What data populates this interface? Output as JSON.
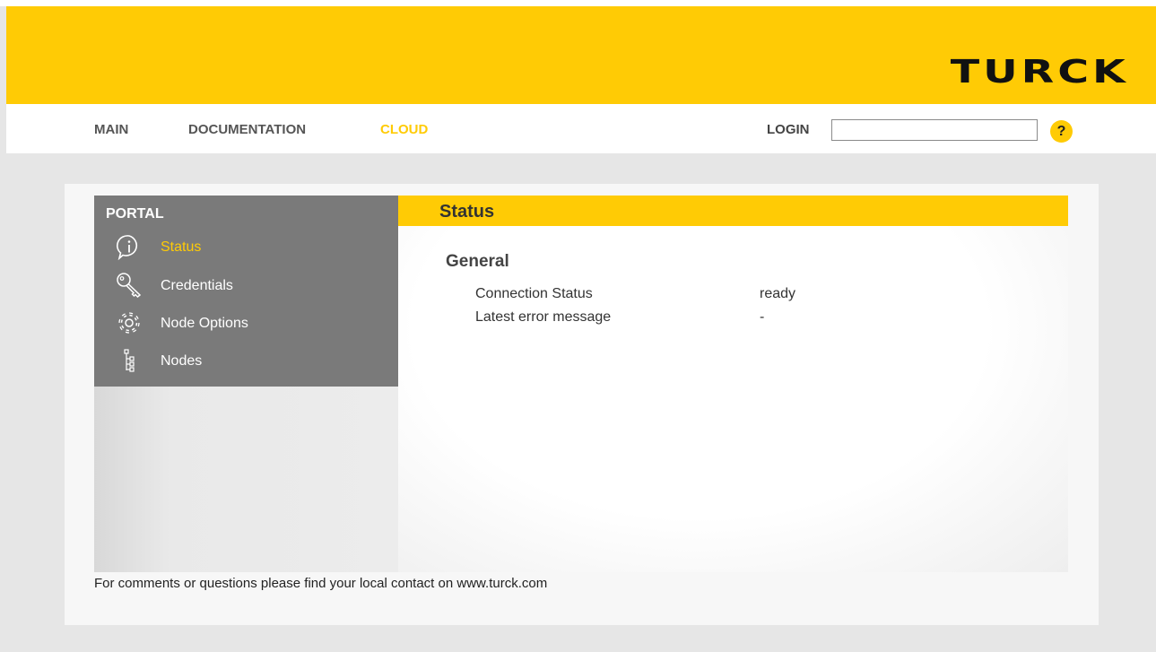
{
  "brand": {
    "logo_text": "TURCK",
    "accent_color": "#ffcb05"
  },
  "nav": {
    "items": [
      {
        "label": "MAIN"
      },
      {
        "label": "DOCUMENTATION"
      },
      {
        "label": "CLOUD",
        "active": true
      }
    ],
    "login_label": "LOGIN",
    "login_value": "",
    "help_label": "?"
  },
  "sidebar": {
    "title": "PORTAL",
    "items": [
      {
        "label": "Status",
        "icon": "info-icon",
        "active": true
      },
      {
        "label": "Credentials",
        "icon": "key-icon"
      },
      {
        "label": "Node Options",
        "icon": "gear-icon"
      },
      {
        "label": "Nodes",
        "icon": "tree-icon"
      }
    ]
  },
  "main": {
    "title": "Status",
    "section_title": "General",
    "rows": [
      {
        "key": "Connection Status",
        "value": "ready"
      },
      {
        "key": "Latest error message",
        "value": "-"
      }
    ]
  },
  "footer": {
    "text": "For comments or questions please find your local contact on www.turck.com"
  }
}
